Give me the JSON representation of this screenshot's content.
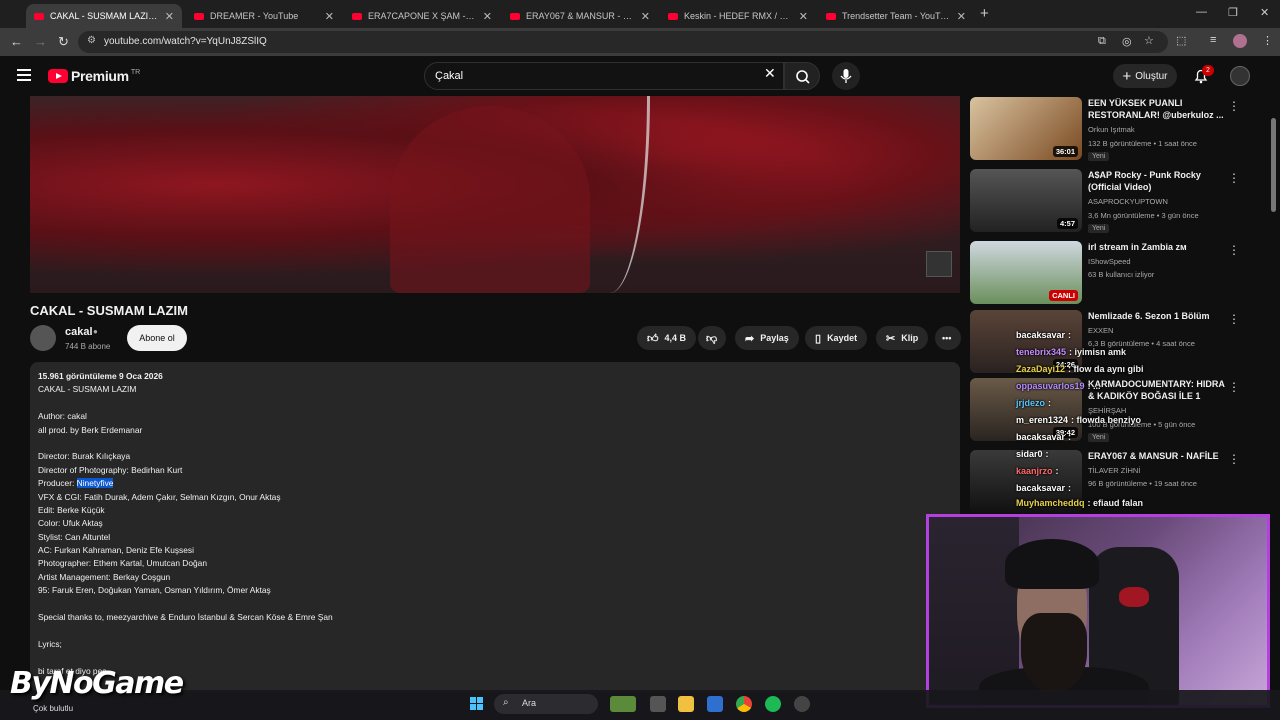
{
  "browser": {
    "tabs": [
      {
        "label": "CAKAL - SUSMAM LAZIM - YouTube",
        "active": true
      },
      {
        "label": "DREAMER - YouTube",
        "active": false
      },
      {
        "label": "ERA7CAPONE X ŞAM - BANA S...",
        "active": false
      },
      {
        "label": "ERAY067 & MANSUR - NAFİLE",
        "active": false
      },
      {
        "label": "Keskin - HEDEF RMX / PROD. E...",
        "active": false
      },
      {
        "label": "Trendsetter Team - YouTube",
        "active": false
      }
    ],
    "url": "youtube.com/watch?v=YqUnJ8ZSlIQ"
  },
  "header": {
    "logo_text": "Premium",
    "country_code": "TR",
    "search_value": "Çakal",
    "create_label": "Oluştur",
    "notif_count": "2"
  },
  "video": {
    "title": "CAKAL - SUSMAM LAZIM",
    "channel": "cakal",
    "subscribers": "744 B abone",
    "subscribe_label": "Abone ol",
    "likes": "4,4 B",
    "share_label": "Paylaş",
    "save_label": "Kaydet",
    "clip_label": "Klip"
  },
  "description": {
    "meta": "15.961 görüntüleme  9 Oca 2026",
    "lines": [
      "CAKAL - SUSMAM LAZIM",
      "",
      "Author: cakal",
      "all prod. by Berk Erdemanar",
      "",
      "Director: Burak Kılıçkaya",
      "Director of Photography: Bedirhan Kurt"
    ],
    "producer_prefix": "Producer: ",
    "producer_name": "Ninetyfive",
    "lines2": [
      "VFX & CGI: Fatih Durak, Adem Çakır, Selman Kızgın, Onur Aktaş",
      "Edit: Berke Küçük",
      "Color: Ufuk Aktaş",
      "Stylist: Can Altuntel",
      "AC: Furkan Kahraman, Deniz Efe Kuşsesi",
      "Photographer: Ethem Kartal, Umutcan Doğan",
      "Artist Management: Berkay Coşgun",
      "95: Faruk Eren, Doğukan Yaman, Osman Yıldırım, Ömer Aktaş",
      "",
      "Special thanks to, meezyarchive & Enduro İstanbul & Sercan Köse & Emre Şan",
      "",
      "Lyrics;",
      "",
      "bi taraf et diyo pes"
    ]
  },
  "recommendations": [
    {
      "title": "EEN YÜKSEK PUANLI RESTORANLAR! @uberkuloz ...",
      "channel": "Orkun Işıtmak",
      "meta": "132 B görüntüleme • 1 saat önce",
      "duration": "36:01",
      "badge": "Yeni",
      "thumb_color": "#6b4a2a"
    },
    {
      "title": "A$AP Rocky - Punk Rocky (Official Video)",
      "channel": "ASAPROCKYUPTOWN",
      "meta": "3,6 Mn görüntüleme • 3 gün önce",
      "duration": "4:57",
      "badge": "Yeni",
      "thumb_color": "#3a3a3a"
    },
    {
      "title": "irl stream in Zambia ᴢᴍ",
      "channel": "IShowSpeed",
      "meta": "63 B kullanıcı izliyor",
      "duration": "CANLI",
      "badge": "",
      "thumb_color": "#5a7a9a"
    },
    {
      "title": "Nemlizade 6. Sezon 1 Bölüm",
      "channel": "EXXEN",
      "meta": "6,3 B görüntüleme • 4 saat önce",
      "duration": "24:26",
      "badge": "",
      "thumb_color": "#4a3a32"
    },
    {
      "title": "KARMADOCUMENTARY: HIDRA & KADIKÖY BOĞASI İLE 1 GÜN...",
      "channel": "ŞEHİRŞAH",
      "meta": "100 B görüntüleme • 5 gün önce",
      "duration": "39:42",
      "badge": "Yeni",
      "thumb_color": "#5a4a3a"
    },
    {
      "title": "ERAY067 & MANSUR - NAFİLE",
      "channel": "TİLAVER ZİHNİ",
      "meta": "96 B görüntüleme • 19 saat önce",
      "duration": "",
      "badge": "",
      "thumb_color": "#2a2a2a"
    }
  ],
  "chat": [
    {
      "user": "bacaksavar",
      "text": ":",
      "color": "#ffffff"
    },
    {
      "user": "tenebrix345",
      "text": ": iyimisn amk",
      "color": "#c68cff"
    },
    {
      "user": "ZazaDayi12",
      "text": ": flow da aynı gibi",
      "color": "#e8d34a"
    },
    {
      "user": "oppasuvarlos19",
      "text": ": ...",
      "color": "#b48cff"
    },
    {
      "user": "jrjdezo",
      "text": ":",
      "color": "#5ac8ff"
    },
    {
      "user": "m_eren1324",
      "text": ": flowda benziyo",
      "color": "#ffffff"
    },
    {
      "user": "bacaksavar",
      "text": ":",
      "color": "#ffffff"
    },
    {
      "user": "sidar0",
      "text": ":",
      "color": "#ffffff"
    },
    {
      "user": "kaanjrzo",
      "text": ":",
      "color": "#ff6a6a"
    },
    {
      "user": "bacaksavar",
      "text": ":",
      "color": "#ffffff"
    },
    {
      "user": "Muyhamcheddq",
      "text": ": efiaud falan",
      "color": "#e8d34a"
    }
  ],
  "overlay": {
    "watermark": "ByNoGame",
    "weather": "Çok bulutlu"
  },
  "taskbar": {
    "search_placeholder": "Ara"
  }
}
